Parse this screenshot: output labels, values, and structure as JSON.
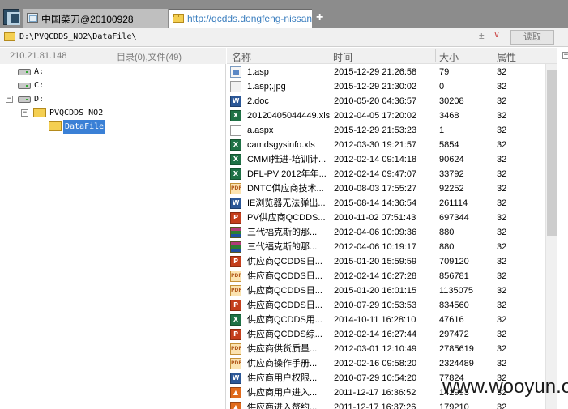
{
  "tabs": [
    {
      "label": "中国菜刀@20100928"
    },
    {
      "label": "http://qcdds.dongfeng-nissan..."
    }
  ],
  "new_tab_label": "+",
  "address_bar": {
    "path": "D:\\PVQCDDS_NO2\\DataFile\\",
    "plus_label": "±",
    "dropdown_label": "∨",
    "read_button": "读取"
  },
  "left_panel": {
    "ip": "210.21.81.148",
    "dir_info": "目录(0),文件(49)",
    "tree": [
      {
        "label": "A:",
        "expander": ""
      },
      {
        "label": "C:",
        "expander": ""
      },
      {
        "label": "D:",
        "expander": "−"
      },
      {
        "label": "PVQCDDS_NO2",
        "expander": "−"
      },
      {
        "label": "DataFile",
        "expander": ""
      }
    ]
  },
  "columns": {
    "name": "名称",
    "time": "时间",
    "size": "大小",
    "attr": "属性"
  },
  "files": [
    {
      "name": "1.asp",
      "time": "2015-12-29 21:26:58",
      "size": "79",
      "attr": "32",
      "icon": "asp-icon"
    },
    {
      "name": "1.asp;.jpg",
      "time": "2015-12-29 21:30:02",
      "size": "0",
      "attr": "32",
      "icon": "jpg-icon"
    },
    {
      "name": "2.doc",
      "time": "2010-05-20 04:36:57",
      "size": "30208",
      "attr": "32",
      "icon": "doc-icon"
    },
    {
      "name": "20120405044449.xls",
      "time": "2012-04-05 17:20:02",
      "size": "3468",
      "attr": "32",
      "icon": "xls-icon"
    },
    {
      "name": "a.aspx",
      "time": "2015-12-29 21:53:23",
      "size": "1",
      "attr": "32",
      "icon": "aspx-icon"
    },
    {
      "name": "camdsgysinfo.xls",
      "time": "2012-03-30 19:21:57",
      "size": "5854",
      "attr": "32",
      "icon": "xls-icon"
    },
    {
      "name": "CMMI推进-培训计...",
      "time": "2012-02-14 09:14:18",
      "size": "90624",
      "attr": "32",
      "icon": "xls-icon"
    },
    {
      "name": "DFL-PV 2012年年...",
      "time": "2012-02-14 09:47:07",
      "size": "33792",
      "attr": "32",
      "icon": "xls-icon"
    },
    {
      "name": "DNTC供应商技术...",
      "time": "2010-08-03 17:55:27",
      "size": "92252",
      "attr": "32",
      "icon": "pdf-icon"
    },
    {
      "name": "IE浏览器无法弹出...",
      "time": "2015-08-14 14:36:54",
      "size": "261114",
      "attr": "32",
      "icon": "doc-icon"
    },
    {
      "name": "PV供应商QCDDS...",
      "time": "2010-11-02 07:51:43",
      "size": "697344",
      "attr": "32",
      "icon": "ppt-icon"
    },
    {
      "name": "三代福克斯的那...",
      "time": "2012-04-06 10:09:36",
      "size": "880",
      "attr": "32",
      "icon": "rar-icon"
    },
    {
      "name": "三代福克斯的那...",
      "time": "2012-04-06 10:19:17",
      "size": "880",
      "attr": "32",
      "icon": "rar-icon"
    },
    {
      "name": "供应商QCDDS日...",
      "time": "2015-01-20 15:59:59",
      "size": "709120",
      "attr": "32",
      "icon": "ppt-icon"
    },
    {
      "name": "供应商QCDDS日...",
      "time": "2012-02-14 16:27:28",
      "size": "856781",
      "attr": "32",
      "icon": "pdf-icon"
    },
    {
      "name": "供应商QCDDS日...",
      "time": "2015-01-20 16:01:15",
      "size": "1135075",
      "attr": "32",
      "icon": "pdf-icon"
    },
    {
      "name": "供应商QCDDS日...",
      "time": "2010-07-29 10:53:53",
      "size": "834560",
      "attr": "32",
      "icon": "ppt-icon"
    },
    {
      "name": "供应商QCDDS用...",
      "time": "2014-10-11 16:28:10",
      "size": "47616",
      "attr": "32",
      "icon": "xls-icon"
    },
    {
      "name": "供应商QCDDS综...",
      "time": "2012-02-14 16:27:44",
      "size": "297472",
      "attr": "32",
      "icon": "ppt-icon"
    },
    {
      "name": "供应商供货质量...",
      "time": "2012-03-01 12:10:49",
      "size": "2785619",
      "attr": "32",
      "icon": "pdf-icon"
    },
    {
      "name": "供应商操作手册...",
      "time": "2012-02-16 09:58:20",
      "size": "2324489",
      "attr": "32",
      "icon": "pdf-icon"
    },
    {
      "name": "供应商用户权限...",
      "time": "2010-07-29 10:54:20",
      "size": "77824",
      "attr": "32",
      "icon": "doc-icon"
    },
    {
      "name": "供应商用户进入...",
      "time": "2011-12-17 16:36:52",
      "size": "142993",
      "attr": "32",
      "icon": "html-icon"
    },
    {
      "name": "供应商进入赘约...",
      "time": "2011-12-17 16:37:26",
      "size": "179210",
      "attr": "32",
      "icon": "html-icon"
    }
  ],
  "side_toggle": "−",
  "watermark": "www.wooyun.org"
}
